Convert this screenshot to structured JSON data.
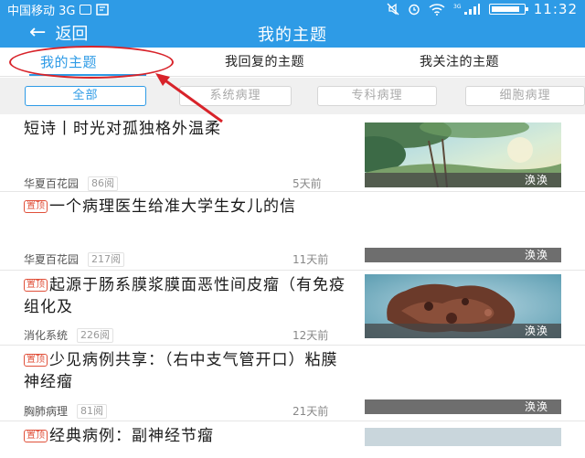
{
  "status_bar": {
    "carrier": "中国移动 3G",
    "time": "11:32",
    "network_badge": "3G",
    "icons": [
      "sim-icon",
      "notification-icon",
      "mute-icon",
      "alarm-icon",
      "wifi-icon",
      "signal-icon",
      "battery-icon"
    ]
  },
  "header": {
    "back_label": "返回",
    "title": "我的主题"
  },
  "tabs": [
    {
      "label": "我的主题",
      "active": true
    },
    {
      "label": "我回复的主题",
      "active": false
    },
    {
      "label": "我关注的主题",
      "active": false
    }
  ],
  "filters": [
    {
      "label": "全部",
      "active": true
    },
    {
      "label": "系统病理",
      "active": false
    },
    {
      "label": "专科病理",
      "active": false
    },
    {
      "label": "细胞病理",
      "active": false
    }
  ],
  "posts": [
    {
      "pinned": false,
      "pin_label": "",
      "title": "短诗丨时光对孤独格外温柔",
      "forum": "华夏百花园",
      "views": "86阅",
      "time": "5天前",
      "author": "涣涣",
      "has_image": true
    },
    {
      "pinned": true,
      "pin_label": "置顶",
      "title": "一个病理医生给准大学生女儿的信",
      "forum": "华夏百花园",
      "views": "217阅",
      "time": "11天前",
      "author": "涣涣",
      "has_image": false
    },
    {
      "pinned": true,
      "pin_label": "置顶",
      "title": "起源于肠系膜浆膜面恶性间皮瘤（有免疫组化及",
      "forum": "消化系统",
      "views": "226阅",
      "time": "12天前",
      "author": "涣涣",
      "has_image": true
    },
    {
      "pinned": true,
      "pin_label": "置顶",
      "title": "少见病例共享：（右中支气管开口）粘膜神经瘤",
      "forum": "胸肺病理",
      "views": "81阅",
      "time": "21天前",
      "author": "涣涣",
      "has_image": false
    },
    {
      "pinned": true,
      "pin_label": "置顶",
      "title": "经典病例：副神经节瘤",
      "forum": "",
      "views": "",
      "time": "",
      "author": "",
      "has_image": true
    }
  ],
  "colors": {
    "primary": "#2E9BE6",
    "annotation": "#d8232a",
    "pin": "#e0503a"
  }
}
